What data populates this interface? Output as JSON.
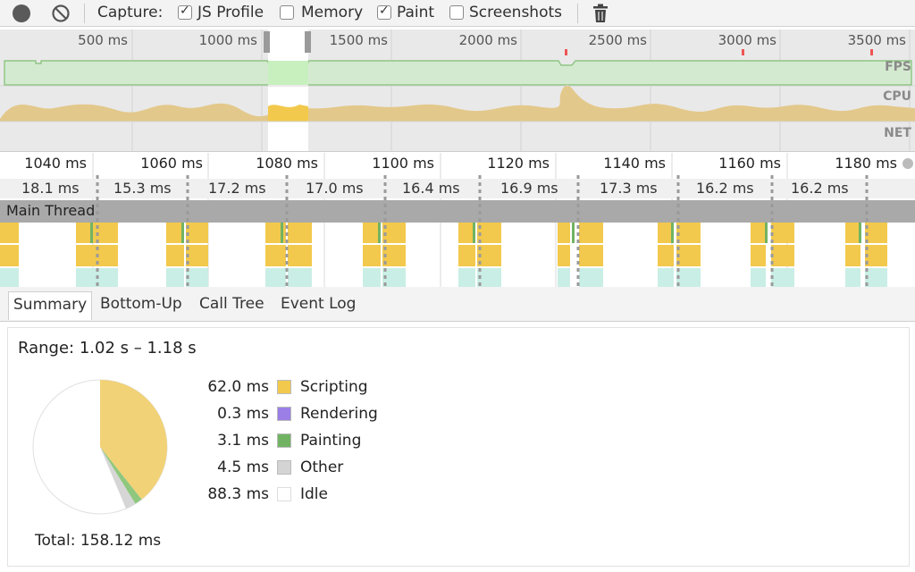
{
  "toolbar": {
    "capture_label": "Capture:",
    "options": [
      {
        "label": "JS Profile",
        "checked": true
      },
      {
        "label": "Memory",
        "checked": false
      },
      {
        "label": "Paint",
        "checked": true
      },
      {
        "label": "Screenshots",
        "checked": false
      }
    ]
  },
  "overview": {
    "ticks": [
      "500 ms",
      "1000 ms",
      "1500 ms",
      "2000 ms",
      "2500 ms",
      "3000 ms",
      "3500 ms"
    ],
    "rows": {
      "fps": "FPS",
      "cpu": "CPU",
      "net": "NET"
    }
  },
  "flame": {
    "ticks": [
      "1040 ms",
      "1060 ms",
      "1080 ms",
      "1100 ms",
      "1120 ms",
      "1140 ms",
      "1160 ms",
      "1180 ms"
    ],
    "frames": [
      "18.1 ms",
      "15.3 ms",
      "17.2 ms",
      "17.0 ms",
      "16.4 ms",
      "16.9 ms",
      "17.3 ms",
      "16.2 ms",
      "16.2 ms"
    ],
    "main_thread": "Main Thread"
  },
  "tabs": [
    "Summary",
    "Bottom-Up",
    "Call Tree",
    "Event Log"
  ],
  "summary": {
    "range": "Range: 1.02 s – 1.18 s",
    "legend": [
      {
        "value": "62.0 ms",
        "name": "Scripting",
        "color": "#f2c94c"
      },
      {
        "value": "0.3 ms",
        "name": "Rendering",
        "color": "#9b7fe6"
      },
      {
        "value": "3.1 ms",
        "name": "Painting",
        "color": "#71b363"
      },
      {
        "value": "4.5 ms",
        "name": "Other",
        "color": "#d4d4d4"
      },
      {
        "value": "88.3 ms",
        "name": "Idle",
        "color": "#ffffff"
      }
    ],
    "total": "Total: 158.12 ms"
  }
}
